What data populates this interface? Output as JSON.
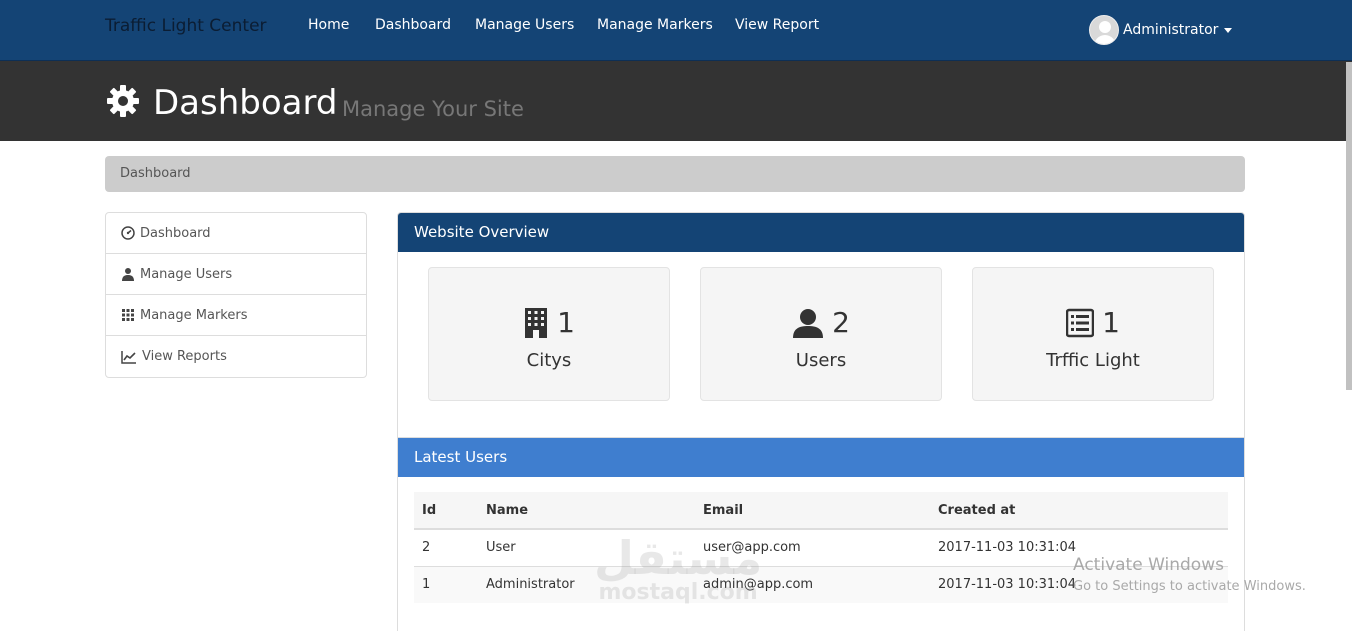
{
  "navbar": {
    "brand": "Traffic Light Center",
    "links": [
      "Home",
      "Dashboard",
      "Manage Users",
      "Manage Markers",
      "View Report"
    ],
    "user": "Administrator"
  },
  "header": {
    "title": "Dashboard",
    "subtitle": "Manage Your Site"
  },
  "breadcrumb": "Dashboard",
  "sidebar": {
    "items": [
      {
        "label": "Dashboard",
        "icon": "dashboard-icon"
      },
      {
        "label": "Manage Users",
        "icon": "user-icon"
      },
      {
        "label": "Manage Markers",
        "icon": "grid-icon"
      },
      {
        "label": "View Reports",
        "icon": "chart-icon"
      }
    ]
  },
  "overview": {
    "title": "Website Overview",
    "stats": [
      {
        "value": "1",
        "label": "Citys",
        "icon": "building-icon"
      },
      {
        "value": "2",
        "label": "Users",
        "icon": "user-icon"
      },
      {
        "value": "1",
        "label": "Trffic Light",
        "icon": "list-icon"
      }
    ]
  },
  "latest_users": {
    "title": "Latest Users",
    "columns": [
      "Id",
      "Name",
      "Email",
      "Created at"
    ],
    "rows": [
      [
        "2",
        "User",
        "user@app.com",
        "2017-11-03 10:31:04"
      ],
      [
        "1",
        "Administrator",
        "admin@app.com",
        "2017-11-03 10:31:04"
      ]
    ]
  },
  "overlay": {
    "activate_title": "Activate Windows",
    "activate_sub": "Go to Settings to activate Windows.",
    "watermark_ar": "مستقل",
    "watermark_en": "mostaql.com"
  },
  "colors": {
    "navbar": "#144475",
    "header": "#333333",
    "panel_head": "#144475",
    "users_head": "#3f7ecf"
  }
}
